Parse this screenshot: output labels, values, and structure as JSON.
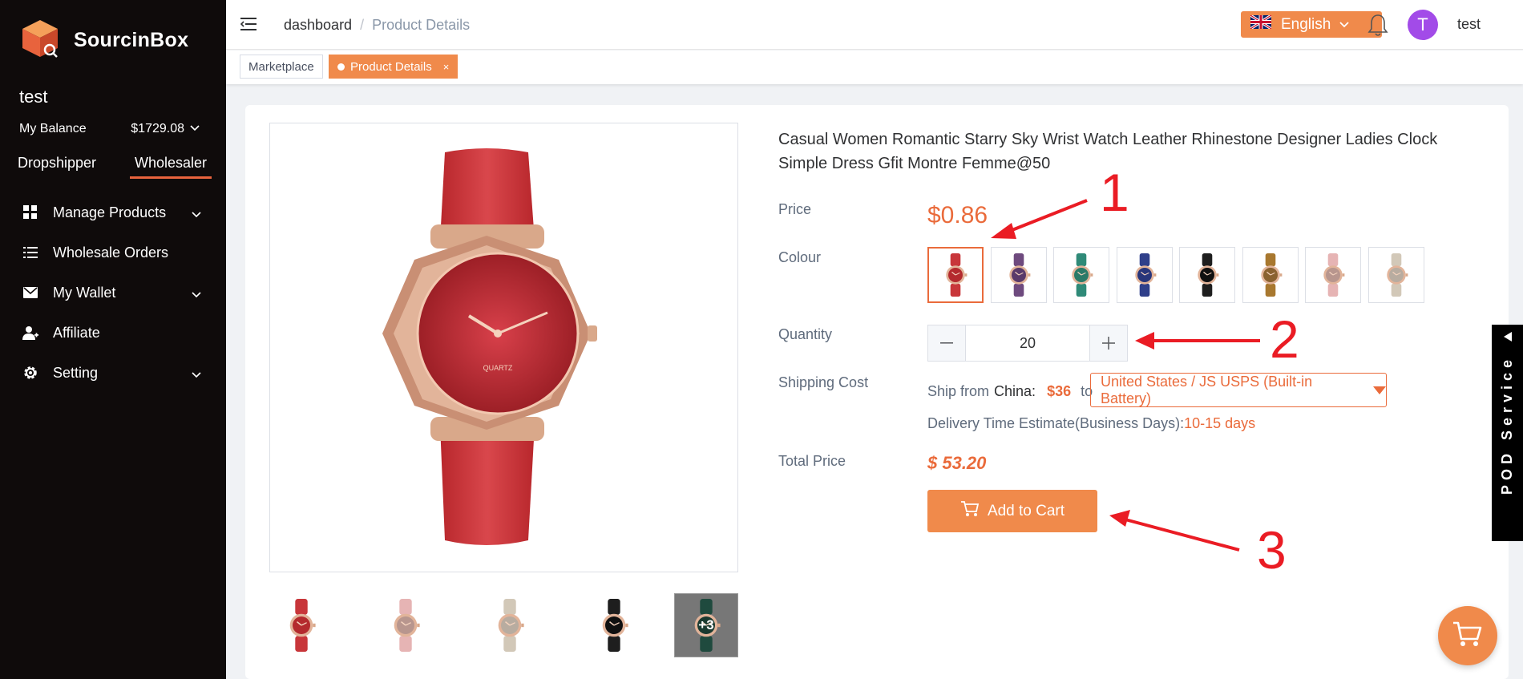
{
  "brand": {
    "name": "SourcinBox"
  },
  "sidebar": {
    "username": "test",
    "balance_label": "My Balance",
    "balance_value": "$1729.08",
    "roles": [
      {
        "label": "Dropshipper"
      },
      {
        "label": "Wholesaler"
      }
    ],
    "active_role": "Wholesaler",
    "menu": [
      {
        "label": "Manage Products",
        "icon": "grid-icon",
        "expandable": true
      },
      {
        "label": "Wholesale Orders",
        "icon": "list-icon",
        "expandable": false
      },
      {
        "label": "My Wallet",
        "icon": "envelope-icon",
        "expandable": true
      },
      {
        "label": "Affiliate",
        "icon": "user-plus-icon",
        "expandable": false
      },
      {
        "label": "Setting",
        "icon": "gear-icon",
        "expandable": true
      }
    ]
  },
  "header": {
    "breadcrumb": [
      "dashboard",
      "Product Details"
    ],
    "language": "English",
    "language_flag": "uk-flag-icon",
    "avatar_letter": "T",
    "username": "test"
  },
  "tabs": [
    {
      "label": "Marketplace",
      "active": false
    },
    {
      "label": "Product Details",
      "active": true,
      "close": "×"
    }
  ],
  "product": {
    "title": "Casual Women Romantic Starry Sky Wrist Watch Leather Rhinestone Designer Ladies Clock Simple Dress Gfit Montre Femme@50",
    "price_label": "Price",
    "price": "$0.86",
    "colour_label": "Colour",
    "colours": [
      {
        "strap": "#c8363a",
        "dial": "#b42a2e"
      },
      {
        "strap": "#6e4a7e",
        "dial": "#5a3a6a"
      },
      {
        "strap": "#2f8a78",
        "dial": "#2a7a68"
      },
      {
        "strap": "#2f3f8a",
        "dial": "#28357a"
      },
      {
        "strap": "#1e1e1e",
        "dial": "#101010"
      },
      {
        "strap": "#a8782f",
        "dial": "#8a6230"
      },
      {
        "strap": "#e6b4b4",
        "dial": "#b8968e"
      },
      {
        "strap": "#d2c8b8",
        "dial": "#b8aca0"
      }
    ],
    "selected_colour": 0,
    "quantity_label": "Quantity",
    "quantity": "20",
    "shipping_label": "Shipping Cost",
    "ship_from_prefix": "Ship from",
    "ship_from_country": "China:",
    "ship_cost": "$36",
    "ship_to": "to",
    "ship_method": "United States / JS USPS (Built-in Battery)",
    "delivery_label": "Delivery Time Estimate(Business Days):",
    "delivery_days": "10-15 days",
    "total_label": "Total Price",
    "total": "$ 53.20",
    "add_to_cart": "Add to Cart",
    "thumbnails": [
      {
        "strap": "#c8363a",
        "dial": "#b42a2e"
      },
      {
        "strap": "#e6b4b4",
        "dial": "#b8968e"
      },
      {
        "strap": "#d2c8b8",
        "dial": "#b8aca0"
      },
      {
        "strap": "#1e1e1e",
        "dial": "#101010"
      },
      {
        "strap": "#1f4a3e",
        "dial": "#1a3a30"
      }
    ],
    "more_thumbs": "+3"
  },
  "pod_service": "POD Service",
  "annotations": [
    "1",
    "2",
    "3"
  ],
  "colors": {
    "accent": "#f08a4b",
    "price": "#ea6b3b",
    "sidebar_bg": "#0f0b0b",
    "annotation": "#ea1c24"
  }
}
